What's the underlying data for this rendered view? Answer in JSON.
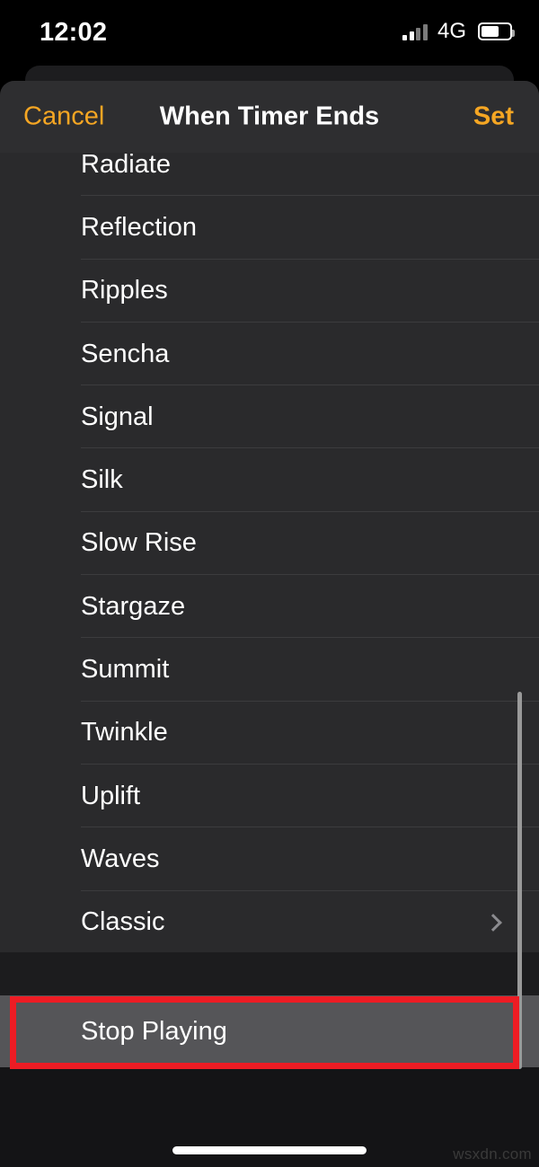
{
  "status_bar": {
    "time": "12:02",
    "network_type": "4G",
    "signal_icon": "cellular-signal-icon",
    "signal_bars_filled": 2,
    "signal_bars_total": 4,
    "battery_icon": "battery-icon",
    "battery_level_percent": 56
  },
  "sheet": {
    "title": "When Timer Ends",
    "cancel_label": "Cancel",
    "set_label": "Set",
    "accent_color": "#F5A623",
    "background_color": "#2a2a2c",
    "header_color": "#2e2e30"
  },
  "tone_list": {
    "items": [
      {
        "label": "Radiate",
        "has_chevron": false
      },
      {
        "label": "Reflection",
        "has_chevron": false
      },
      {
        "label": "Ripples",
        "has_chevron": false
      },
      {
        "label": "Sencha",
        "has_chevron": false
      },
      {
        "label": "Signal",
        "has_chevron": false
      },
      {
        "label": "Silk",
        "has_chevron": false
      },
      {
        "label": "Slow Rise",
        "has_chevron": false
      },
      {
        "label": "Stargaze",
        "has_chevron": false
      },
      {
        "label": "Summit",
        "has_chevron": false
      },
      {
        "label": "Twinkle",
        "has_chevron": false
      },
      {
        "label": "Uplift",
        "has_chevron": false
      },
      {
        "label": "Waves",
        "has_chevron": false
      },
      {
        "label": "Classic",
        "has_chevron": true
      }
    ],
    "chevron_icon": "chevron-right-icon"
  },
  "stop_playing": {
    "label": "Stop Playing",
    "highlight_color": "#555558"
  },
  "annotation": {
    "color": "#ED1C24",
    "target": "Stop Playing"
  },
  "watermark": {
    "text": "wsxdn.com"
  }
}
